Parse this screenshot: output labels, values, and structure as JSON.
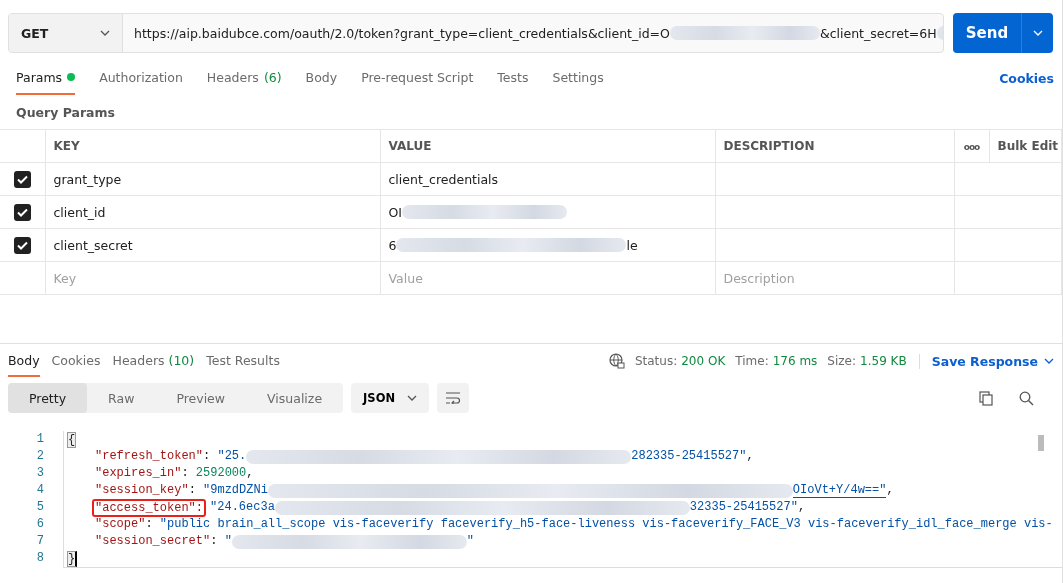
{
  "request": {
    "method": "GET",
    "url": [
      {
        "kind": "text",
        "text": "https://aip.baidubce.com/oauth/2.0/token?grant_type=client_credentials&client_id=O"
      },
      {
        "kind": "blur"
      },
      {
        "kind": "text",
        "text": "&client_secret=6H"
      },
      {
        "kind": "blur"
      }
    ],
    "send": "Send"
  },
  "request_tabs": [
    {
      "label": "Params",
      "dot": true,
      "selected": true
    },
    {
      "label": "Authorization",
      "dot": false,
      "selected": false
    },
    {
      "label": "Headers",
      "count": "(6)",
      "dot": false,
      "selected": false
    },
    {
      "label": "Body",
      "dot": false,
      "selected": false
    },
    {
      "label": "Pre-request Script",
      "dot": false,
      "selected": false
    },
    {
      "label": "Tests",
      "dot": false,
      "selected": false
    },
    {
      "label": "Settings",
      "dot": false,
      "selected": false
    }
  ],
  "cookies_link": "Cookies",
  "section_title": "Query Params",
  "params_table": {
    "columns": [
      "KEY",
      "VALUE",
      "DESCRIPTION"
    ],
    "more": "ooo",
    "bulk_edit": "Bulk Edit",
    "rows": [
      {
        "checked": true,
        "key": "grant_type",
        "value": [
          {
            "kind": "text",
            "text": "client_credentials"
          }
        ]
      },
      {
        "checked": true,
        "key": "client_id",
        "value": [
          {
            "kind": "text",
            "text": "OI"
          },
          {
            "kind": "blur"
          }
        ]
      },
      {
        "checked": true,
        "key": "client_secret",
        "value": [
          {
            "kind": "text",
            "text": "6"
          },
          {
            "kind": "blur"
          },
          {
            "kind": "text",
            "text": "le"
          }
        ]
      }
    ],
    "placeholders": {
      "key": "Key",
      "value": "Value",
      "description": "Description"
    }
  },
  "response_tabs": [
    {
      "label": "Body",
      "selected": true
    },
    {
      "label": "Cookies",
      "selected": false
    },
    {
      "label": "Headers",
      "count": "(10)",
      "selected": false
    },
    {
      "label": "Test Results",
      "selected": false
    }
  ],
  "response_status": [
    {
      "label": "Status:",
      "value": "200 OK"
    },
    {
      "label": "Time:",
      "value": "176 ms"
    },
    {
      "label": "Size:",
      "value": "1.59 KB"
    }
  ],
  "save_response": "Save Response",
  "view_modes": [
    {
      "label": "Pretty",
      "selected": true
    },
    {
      "label": "Raw",
      "selected": false
    },
    {
      "label": "Preview",
      "selected": false
    },
    {
      "label": "Visualize",
      "selected": false
    }
  ],
  "format": "JSON",
  "code_lines": [
    {
      "number": "1",
      "segments": [
        {
          "kind": "bracket",
          "text": "{"
        }
      ]
    },
    {
      "number": "2",
      "segments": [
        {
          "kind": "key",
          "text": "\"refresh_token\""
        },
        {
          "kind": "punct",
          "text": ": "
        },
        {
          "kind": "string",
          "text": "\"25."
        },
        {
          "kind": "blur"
        },
        {
          "kind": "string",
          "text": "282335-25415527\""
        },
        {
          "kind": "punct",
          "text": ","
        }
      ]
    },
    {
      "number": "3",
      "segments": [
        {
          "kind": "key",
          "text": "\"expires_in\""
        },
        {
          "kind": "punct",
          "text": ": "
        },
        {
          "kind": "number",
          "text": "2592000"
        },
        {
          "kind": "punct",
          "text": ","
        }
      ]
    },
    {
      "number": "4",
      "segments": [
        {
          "kind": "key",
          "text": "\"session_key\""
        },
        {
          "kind": "punct",
          "text": ": "
        },
        {
          "kind": "string",
          "text": "\"9mzdDZNi"
        },
        {
          "kind": "blur"
        },
        {
          "kind": "link",
          "text": "OIoVt+Y/4w==\""
        },
        {
          "kind": "punct",
          "text": ","
        }
      ]
    },
    {
      "number": "5",
      "segments": [
        {
          "kind": "boxed",
          "text": "\"access_token\":"
        },
        {
          "kind": "string",
          "text": "\"24.6ec3a"
        },
        {
          "kind": "blur"
        },
        {
          "kind": "string",
          "text": "32335-25415527\""
        },
        {
          "kind": "punct",
          "text": ","
        }
      ]
    },
    {
      "number": "6",
      "segments": [
        {
          "kind": "key",
          "text": "\"scope\""
        },
        {
          "kind": "punct",
          "text": ": "
        },
        {
          "kind": "string",
          "text": "\"public brain_all_scope vis-faceverify faceverify_h5-face-liveness vis-faceverify_FACE_V3 vis-faceverify_idl_face_merge vis-"
        }
      ]
    },
    {
      "number": "7",
      "segments": [
        {
          "kind": "key",
          "text": "\"session_secret\""
        },
        {
          "kind": "punct",
          "text": ": "
        },
        {
          "kind": "string",
          "text": "\""
        },
        {
          "kind": "blur"
        },
        {
          "kind": "string",
          "text": "\""
        }
      ]
    },
    {
      "number": "8",
      "segments": [
        {
          "kind": "cursor-bracket",
          "text": "}"
        }
      ]
    }
  ]
}
